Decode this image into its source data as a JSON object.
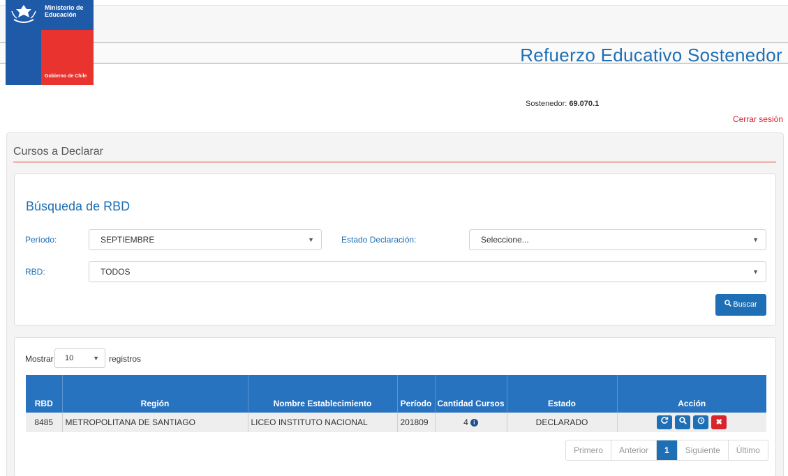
{
  "brand": {
    "line1": "Ministerio de Educación",
    "line2": "Gobierno de Chile",
    "blue": "#1e5aa8",
    "red": "#e8332f"
  },
  "header": {
    "app_title": "Refuerzo Educativo Sostenedor",
    "sostenedor_label": "Sostenedor:",
    "sostenedor_value": "69.070.1",
    "logout": "Cerrar sesión"
  },
  "page": {
    "title": "Cursos a Declarar"
  },
  "search": {
    "title": "Búsqueda de RBD",
    "periodo_label": "Período:",
    "periodo_value": "SEPTIEMBRE",
    "estado_label": "Estado Declaración:",
    "estado_value": "Seleccione...",
    "rbd_label": "RBD:",
    "rbd_value": "TODOS",
    "search_button": "Buscar",
    "search_icon": "search-icon"
  },
  "table": {
    "show_label": "Mostrar",
    "page_size": "10",
    "records_label": "registros",
    "columns": [
      "RBD",
      "Región",
      "Nombre Establecimiento",
      "Período",
      "Cantidad Cursos",
      "Estado",
      "Acción"
    ],
    "rows": [
      {
        "rbd": "8485",
        "region": "METROPOLITANA DE SANTIAGO",
        "nombre": "LICEO INSTITUTO NACIONAL",
        "periodo": "201809",
        "cantidad": "4",
        "estado": "DECLARADO",
        "actions": [
          "refresh-icon",
          "search-icon",
          "clock-icon",
          "close-icon"
        ]
      }
    ]
  },
  "pagination": {
    "first": "Primero",
    "prev": "Anterior",
    "current": "1",
    "next": "Siguiente",
    "last": "Último"
  }
}
